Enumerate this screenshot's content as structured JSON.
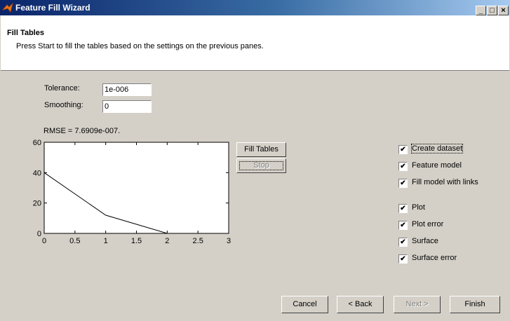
{
  "window": {
    "title": "Feature Fill Wizard",
    "controls": [
      "_",
      "□",
      "×"
    ]
  },
  "header": {
    "title": "Fill Tables",
    "subtitle": "Press Start to fill the tables based on the settings on the previous panes."
  },
  "settings": {
    "tolerance_label": "Tolerance:",
    "tolerance_value": "1e-006",
    "smoothing_label": "Smoothing:",
    "smoothing_value": "0"
  },
  "rmse_text": "RMSE = 7.6909e-007.",
  "actions": {
    "fill_tables": "Fill Tables",
    "stop": "Stop"
  },
  "options": [
    {
      "label": "Create dataset",
      "checked": true
    },
    {
      "label": "Feature model",
      "checked": true
    },
    {
      "label": "Fill model with links",
      "checked": true
    },
    {
      "label": "Plot",
      "checked": true
    },
    {
      "label": "Plot error",
      "checked": true
    },
    {
      "label": "Surface",
      "checked": true
    },
    {
      "label": "Surface error",
      "checked": true
    }
  ],
  "footer": {
    "cancel": "Cancel",
    "back": "< Back",
    "next": "Next >",
    "finish": "Finish"
  },
  "chart_data": {
    "type": "line",
    "x": [
      0,
      1,
      2,
      3
    ],
    "y": [
      40,
      12,
      0,
      0
    ],
    "xlim": [
      0,
      3
    ],
    "ylim": [
      0,
      60
    ],
    "xticks": [
      "0",
      "0.5",
      "1",
      "1.5",
      "2",
      "2.5",
      "3"
    ],
    "yticks": [
      "0",
      "20",
      "40",
      "60"
    ],
    "grid": false
  }
}
